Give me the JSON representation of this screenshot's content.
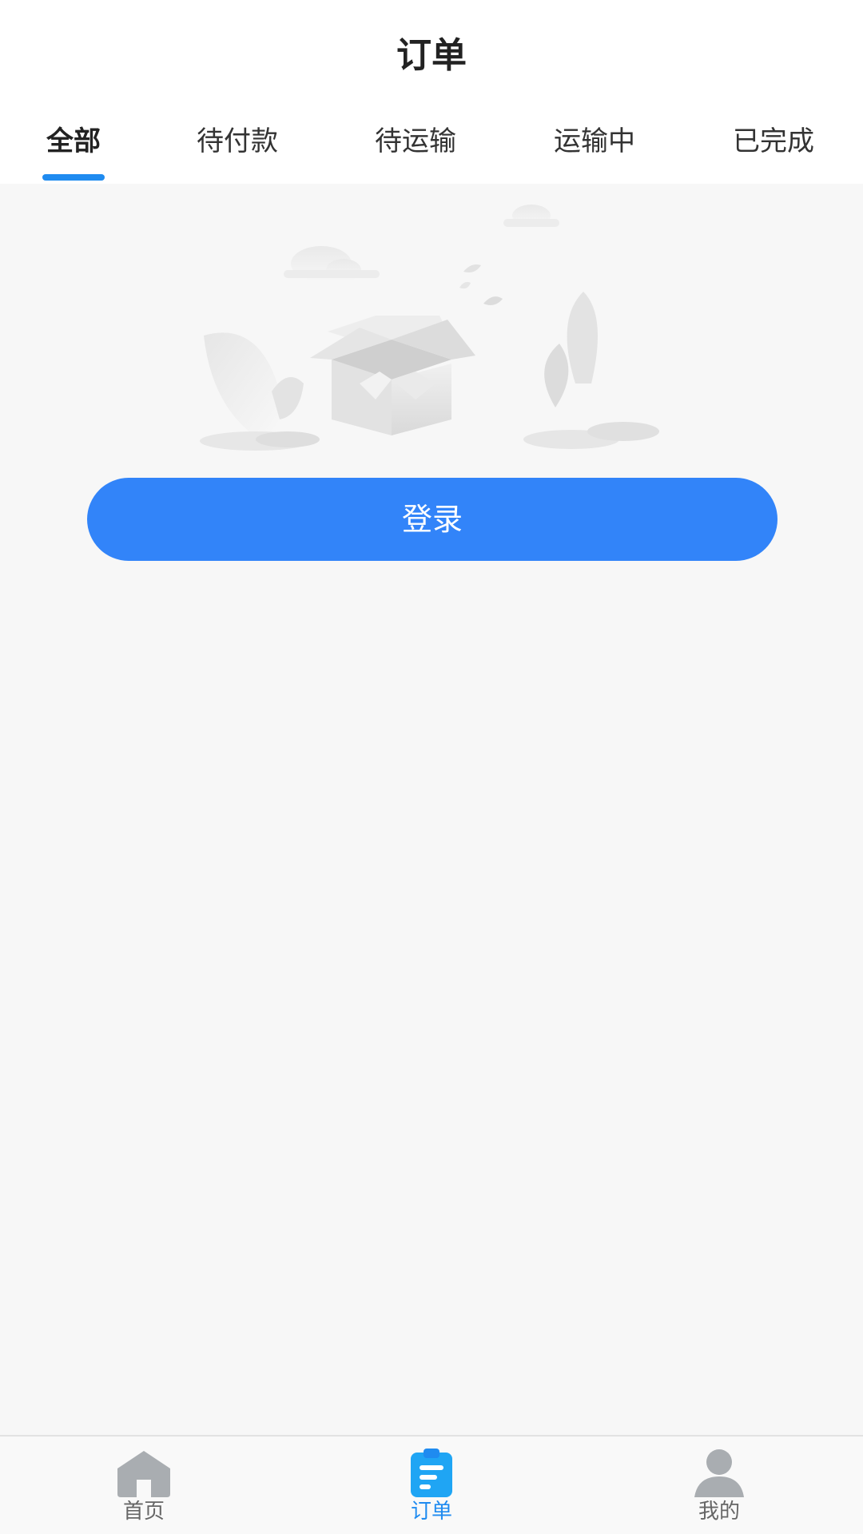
{
  "header": {
    "title": "订单"
  },
  "tabs": [
    {
      "label": "全部",
      "active": true
    },
    {
      "label": "待付款",
      "active": false
    },
    {
      "label": "待运输",
      "active": false
    },
    {
      "label": "运输中",
      "active": false
    },
    {
      "label": "已完成",
      "active": false
    }
  ],
  "empty_state": {
    "illustration": "empty-box-illustration",
    "login_label": "登录"
  },
  "bottom_nav": {
    "items": [
      {
        "label": "首页",
        "icon": "home-icon",
        "active": false
      },
      {
        "label": "订单",
        "icon": "order-clipboard-icon",
        "active": true
      },
      {
        "label": "我的",
        "icon": "user-icon",
        "active": false
      }
    ]
  },
  "colors": {
    "accent": "#1f8bf0",
    "button": "#3284f9",
    "background": "#f7f7f7",
    "header_bg": "#ffffff",
    "inactive_icon": "#a9adb1"
  }
}
